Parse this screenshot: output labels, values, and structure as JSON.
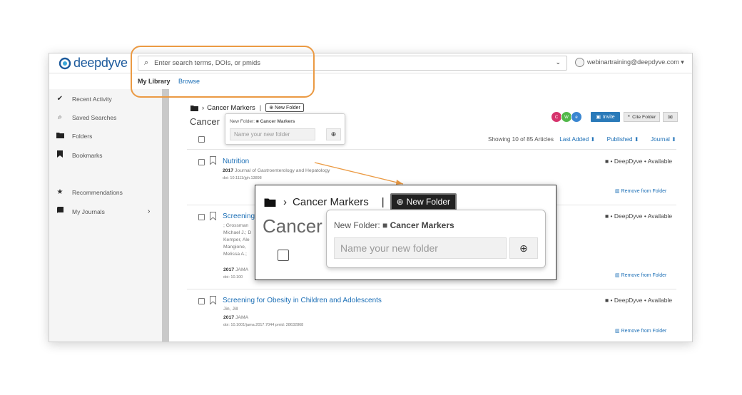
{
  "header": {
    "logo_text": "deepdyve",
    "search_placeholder": "Enter search terms, DOIs, or pmids",
    "user_email": "webinartraining@deepdyve.com ▾"
  },
  "tabs": [
    "My Library",
    "Browse"
  ],
  "sidebar": {
    "items": [
      {
        "label": "Recent Activity",
        "icon": "check-icon"
      },
      {
        "label": "Saved Searches",
        "icon": "search-icon"
      },
      {
        "label": "Folders",
        "icon": "folder-icon"
      },
      {
        "label": "Bookmarks",
        "icon": "bookmark-icon"
      },
      {
        "label": "Recommendations",
        "icon": "star-icon"
      },
      {
        "label": "My Journals",
        "icon": "book-icon"
      }
    ]
  },
  "folder": {
    "breadcrumb": "Cancer Markers",
    "new_folder_label": "New Folder",
    "title_partial": "Cancer",
    "popover_label": "New Folder:",
    "popover_folder": "Cancer Markers",
    "input_placeholder": "Name your new folder"
  },
  "collaborators": [
    "C",
    "W",
    "e"
  ],
  "actions": {
    "invite": "Invite",
    "cite": "Cite Folder"
  },
  "listing": {
    "showing": "Showing 10 of 85 Articles",
    "sorts": [
      "Last Added ⬍",
      "Published ⬍",
      "Journal ⬍"
    ]
  },
  "articles": [
    {
      "title": "Nutrition",
      "year": "2017",
      "journal": "Journal of Gastroenterology and Hepatology",
      "doi": "doi: 10.1111/jgh.13898",
      "availability": "• DeepDyve • Available",
      "remove": "Remove from Folder"
    },
    {
      "title": "Screening",
      "authors": [
        ";  Grossman",
        "Michael J.; D",
        "Kemper, Ale",
        "Mangione,",
        "Melissa A.;"
      ],
      "year": "2017",
      "journal": "JAMA",
      "doi": "doi: 10.100",
      "availability": "• DeepDyve • Available",
      "remove": "Remove from Folder"
    },
    {
      "title": "Screening for Obesity in Children and Adolescents",
      "authors": [
        "Jin, Jill"
      ],
      "year": "2017",
      "journal": "JAMA",
      "doi": "doi: 10.1001/jama.2017.7044",
      "pmid": "pmid: 28632868",
      "availability": "• DeepDyve • Available",
      "remove": "Remove from Folder"
    }
  ],
  "colors": {
    "brand": "#1c5a9c",
    "link": "#1c6fb6",
    "highlight": "#eb9a43"
  }
}
